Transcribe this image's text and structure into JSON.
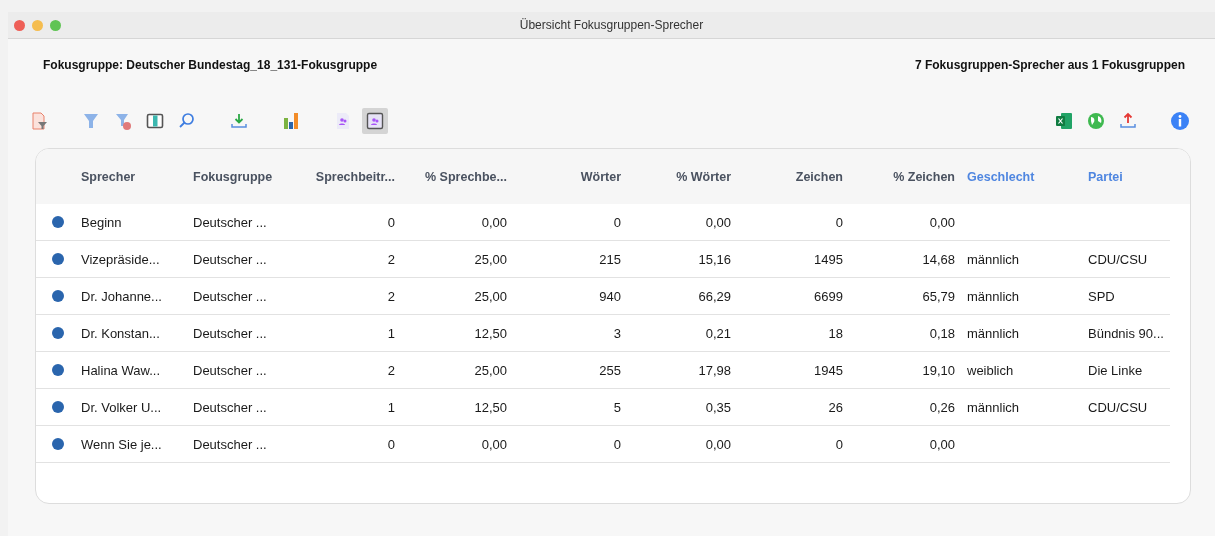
{
  "window": {
    "title": "Übersicht Fokusgruppen-Sprecher"
  },
  "heading": "Fokusgruppe: Deutscher Bundestag_18_131-Fokusgruppe",
  "summary": "7 Fokusgruppen-Sprecher aus 1 Fokusgruppen",
  "toolbar_left": [
    {
      "kind": "doc-filter",
      "selected": false
    },
    {
      "kind": "gap"
    },
    {
      "kind": "filter",
      "selected": false
    },
    {
      "kind": "filter-clear",
      "selected": false
    },
    {
      "kind": "columns",
      "selected": false
    },
    {
      "kind": "search",
      "selected": false
    },
    {
      "kind": "gap"
    },
    {
      "kind": "download",
      "selected": false
    },
    {
      "kind": "gap"
    },
    {
      "kind": "chart",
      "selected": false
    },
    {
      "kind": "gap"
    },
    {
      "kind": "doc-people",
      "selected": false
    },
    {
      "kind": "window-people",
      "selected": true
    }
  ],
  "toolbar_right": [
    {
      "kind": "excel"
    },
    {
      "kind": "globe"
    },
    {
      "kind": "upload"
    },
    {
      "kind": "gap"
    },
    {
      "kind": "info"
    }
  ],
  "table": {
    "columns": [
      {
        "label": "Sprecher",
        "kind": "text",
        "variable": false
      },
      {
        "label": "Fokusgruppe",
        "kind": "text",
        "variable": false
      },
      {
        "label": "Sprechbeitr...",
        "kind": "number",
        "variable": false
      },
      {
        "label": "% Sprechbe...",
        "kind": "number",
        "variable": false
      },
      {
        "label": "Wörter",
        "kind": "number",
        "variable": false
      },
      {
        "label": "% Wörter",
        "kind": "number",
        "variable": false
      },
      {
        "label": "Zeichen",
        "kind": "number",
        "variable": false
      },
      {
        "label": "% Zeichen",
        "kind": "number",
        "variable": false
      },
      {
        "label": "Geschlecht",
        "kind": "text",
        "variable": true
      },
      {
        "label": "Partei",
        "kind": "text",
        "variable": true
      }
    ],
    "rows": [
      {
        "color": "#2a65ad",
        "cells": [
          "Beginn",
          "Deutscher ...",
          "0",
          "0,00",
          "0",
          "0,00",
          "0",
          "0,00",
          "",
          ""
        ]
      },
      {
        "color": "#2a65ad",
        "cells": [
          "Vizepräside...",
          "Deutscher ...",
          "2",
          "25,00",
          "215",
          "15,16",
          "1495",
          "14,68",
          "männlich",
          "CDU/CSU"
        ]
      },
      {
        "color": "#2a65ad",
        "cells": [
          "Dr. Johanne...",
          "Deutscher ...",
          "2",
          "25,00",
          "940",
          "66,29",
          "6699",
          "65,79",
          "männlich",
          "SPD"
        ]
      },
      {
        "color": "#2a65ad",
        "cells": [
          "Dr. Konstan...",
          "Deutscher ...",
          "1",
          "12,50",
          "3",
          "0,21",
          "18",
          "0,18",
          "männlich",
          "Bündnis 90..."
        ]
      },
      {
        "color": "#2a65ad",
        "cells": [
          "Halina Waw...",
          "Deutscher ...",
          "2",
          "25,00",
          "255",
          "17,98",
          "1945",
          "19,10",
          "weiblich",
          "Die Linke"
        ]
      },
      {
        "color": "#2a65ad",
        "cells": [
          "Dr. Volker U...",
          "Deutscher ...",
          "1",
          "12,50",
          "5",
          "0,35",
          "26",
          "0,26",
          "männlich",
          "CDU/CSU"
        ]
      },
      {
        "color": "#2a65ad",
        "cells": [
          "Wenn Sie je...",
          "Deutscher ...",
          "0",
          "0,00",
          "0",
          "0,00",
          "0",
          "0,00",
          "",
          ""
        ]
      }
    ]
  }
}
